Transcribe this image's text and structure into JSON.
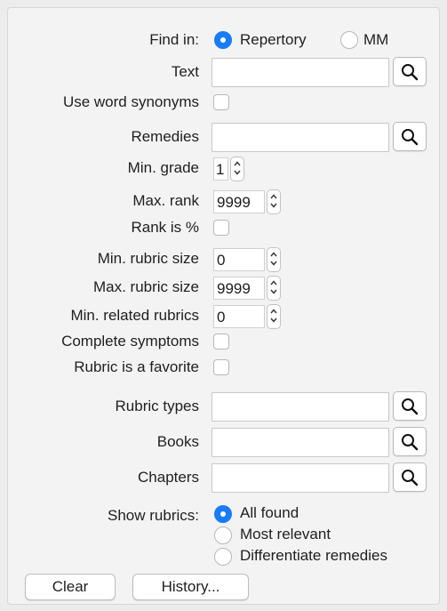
{
  "find_in": {
    "label": "Find in:",
    "options": [
      "Repertory",
      "MM"
    ],
    "selected": "Repertory"
  },
  "text": {
    "label": "Text",
    "value": ""
  },
  "use_word_synonyms": {
    "label": "Use word synonyms",
    "checked": false
  },
  "remedies": {
    "label": "Remedies",
    "value": ""
  },
  "min_grade": {
    "label": "Min. grade",
    "value": "1"
  },
  "max_rank": {
    "label": "Max. rank",
    "value": "9999"
  },
  "rank_is_percent": {
    "label": "Rank is %",
    "checked": false
  },
  "min_rubric_size": {
    "label": "Min. rubric size",
    "value": "0"
  },
  "max_rubric_size": {
    "label": "Max. rubric size",
    "value": "9999"
  },
  "min_related_rubrics": {
    "label": "Min. related rubrics",
    "value": "0"
  },
  "complete_symptoms": {
    "label": "Complete symptoms",
    "checked": false
  },
  "rubric_is_favorite": {
    "label": "Rubric is a favorite",
    "checked": false
  },
  "rubric_types": {
    "label": "Rubric types",
    "value": ""
  },
  "books": {
    "label": "Books",
    "value": ""
  },
  "chapters": {
    "label": "Chapters",
    "value": ""
  },
  "show_rubrics": {
    "label": "Show rubrics:",
    "options": [
      "All found",
      "Most relevant",
      "Differentiate remedies"
    ],
    "selected": "All found"
  },
  "buttons": {
    "clear": "Clear",
    "history": "History..."
  },
  "colors": {
    "accent": "#1a7cf5",
    "panel": "#f3f3f3",
    "background": "#ececec"
  },
  "icons": {
    "search": "magnifier-icon",
    "stepper": "up-down-stepper-icon"
  }
}
